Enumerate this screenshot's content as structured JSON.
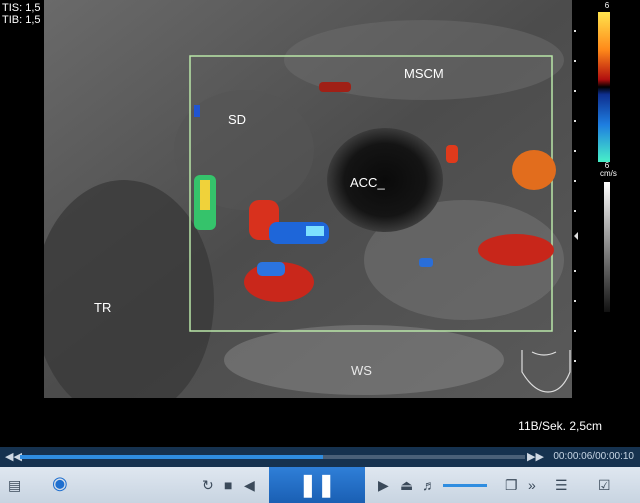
{
  "header": {
    "tis": "TIS: 1,5",
    "tib": "TIB: 1,5"
  },
  "labels": {
    "sd": "SD",
    "mscm": "MSCM",
    "acc": "ACC_",
    "tr": "TR",
    "ws": "WS"
  },
  "scale": {
    "top": "6",
    "bottom": "6",
    "unit": "cm/s"
  },
  "image_info": "11B/Sek. 2,5cm",
  "player": {
    "progress": 0.6,
    "time_display": "00:00:06/00:00:10",
    "volume_level": 0.75
  },
  "icons": [
    "menu-icon",
    "eye-icon",
    "loop-icon",
    "stop-icon",
    "previous-icon",
    "pause-icon",
    "next-icon",
    "eject-icon",
    "volume-icon",
    "fullscreen-icon",
    "expand-icon",
    "playlist-icon",
    "settings-icon"
  ]
}
